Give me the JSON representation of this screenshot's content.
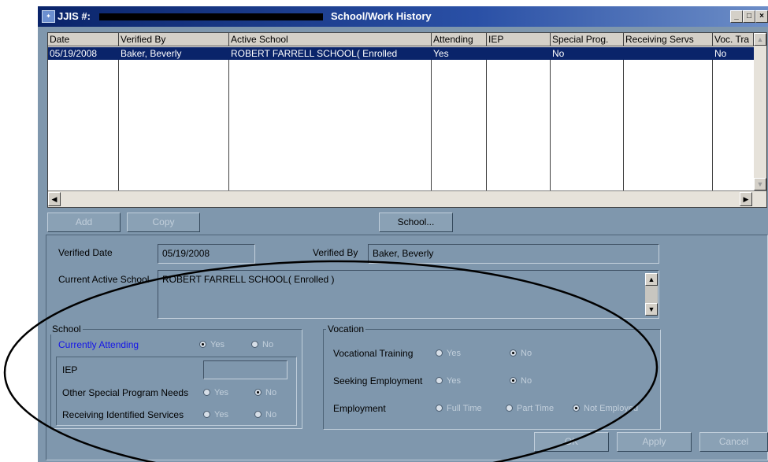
{
  "window": {
    "title_prefix": "JJIS #:",
    "title_suffix": "School/Work History",
    "minimize": "_",
    "maximize": "□",
    "close": "×"
  },
  "grid": {
    "columns": [
      "Date",
      "Verified By",
      "Active School",
      "Attending",
      "IEP",
      "Special Prog.",
      "Receiving Servs",
      "Voc. Tra"
    ],
    "rows": [
      [
        "05/19/2008",
        "Baker, Beverly",
        "ROBERT FARRELL SCHOOL( Enrolled",
        "Yes",
        "",
        "No",
        "",
        "No"
      ]
    ]
  },
  "buttons": {
    "add": "Add",
    "copy": "Copy",
    "school": "School...",
    "ok": "OK",
    "apply": "Apply",
    "cancel": "Cancel"
  },
  "detail": {
    "verified_date_label": "Verified Date",
    "verified_date": "05/19/2008",
    "verified_by_label": "Verified By",
    "verified_by": "Baker, Beverly",
    "current_school_label": "Current Active School",
    "current_school": "ROBERT FARRELL SCHOOL( Enrolled )"
  },
  "school_group": {
    "title": "School",
    "currently_attending": "Currently Attending",
    "iep": "IEP",
    "iep_value": "",
    "other_special": "Other Special Program Needs",
    "receiving_services": "Receiving Identified Services",
    "yes": "Yes",
    "no": "No"
  },
  "vocation_group": {
    "title": "Vocation",
    "vocational_training": "Vocational Training",
    "seeking_employment": "Seeking Employment",
    "employment": "Employment",
    "yes": "Yes",
    "no": "No",
    "full_time": "Full Time",
    "part_time": "Part Time",
    "not_employed": "Not Employed"
  },
  "colors": {
    "window_bg": "#7f97ad",
    "selection": "#0a246a",
    "currently_attending_text": "#1515e8",
    "annotation_ellipse": "#000000"
  }
}
